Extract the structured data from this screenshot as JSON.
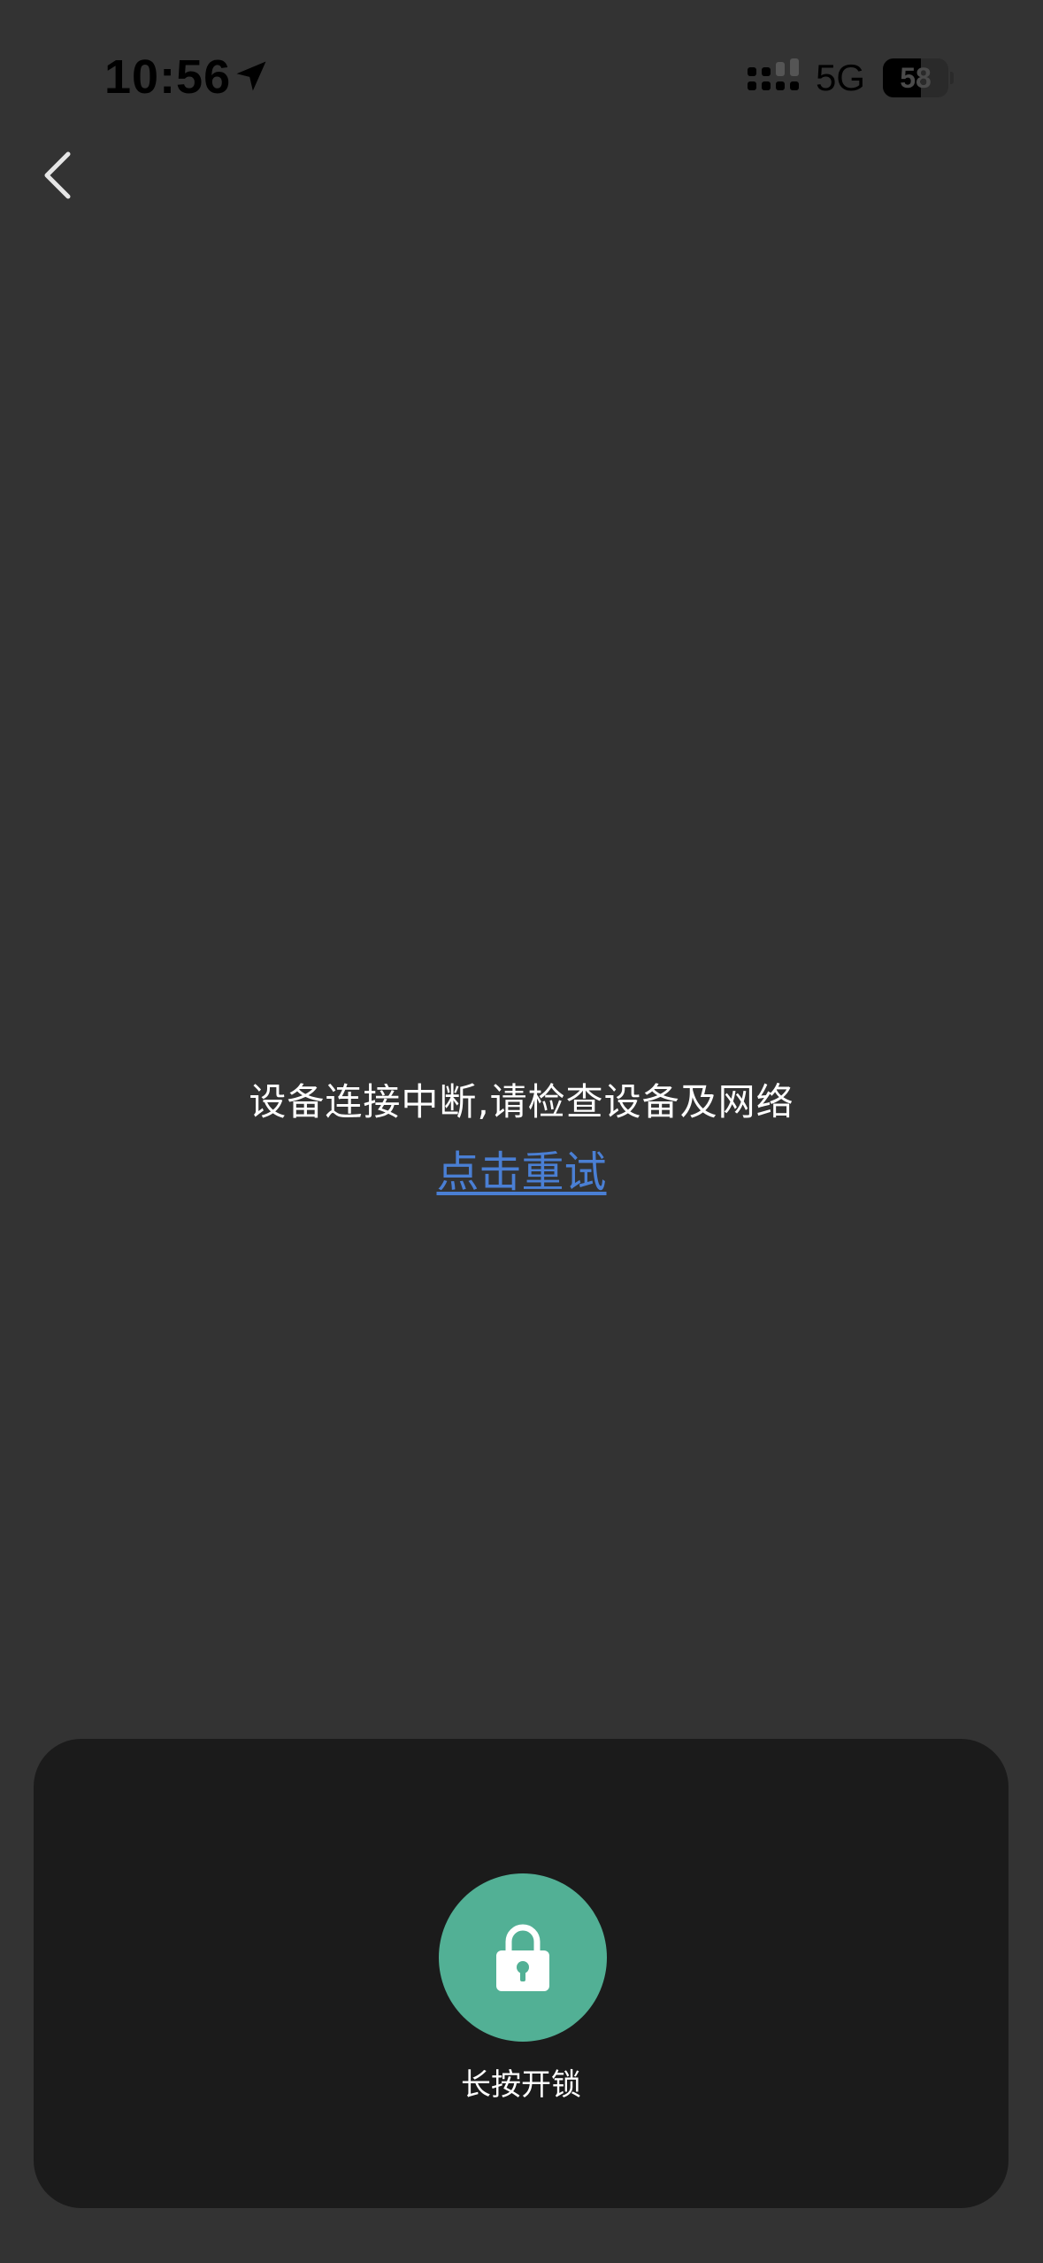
{
  "status_bar": {
    "time": "10:56",
    "network": "5G",
    "battery_level": "58",
    "battery_fraction": 0.58,
    "location_icon": "location-arrow-icon",
    "signal_icon": "cellular-signal-icon"
  },
  "nav": {
    "back_icon": "chevron-left-icon"
  },
  "main": {
    "error_message": "设备连接中断,请检查设备及网络",
    "retry_label": "点击重试"
  },
  "unlock": {
    "icon": "lock-icon",
    "label": "长按开锁"
  },
  "colors": {
    "background": "#333333",
    "panel": "#1b1b1b",
    "accent_green": "#52b095",
    "link_blue": "#4a7fd4"
  }
}
